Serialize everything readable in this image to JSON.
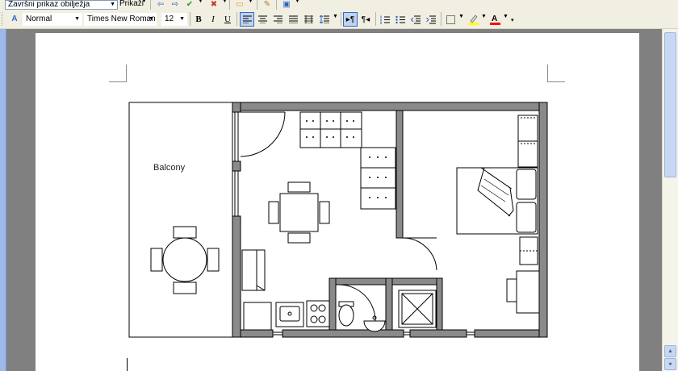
{
  "toolbar_top": {
    "review_combo": "Završni prikaz obilježja",
    "show_menu": "Prikaži"
  },
  "formatting": {
    "style": "Normal",
    "font": "Times New Roman",
    "size": "12",
    "bold": "B",
    "italic": "I",
    "underline": "U"
  },
  "document": {
    "balcony_label": "Balcony"
  },
  "colors": {
    "wall": "#7a7a7a",
    "highlight": "#ffff00",
    "font_color": "#ff0000",
    "active_button": "#c1d2ee"
  }
}
